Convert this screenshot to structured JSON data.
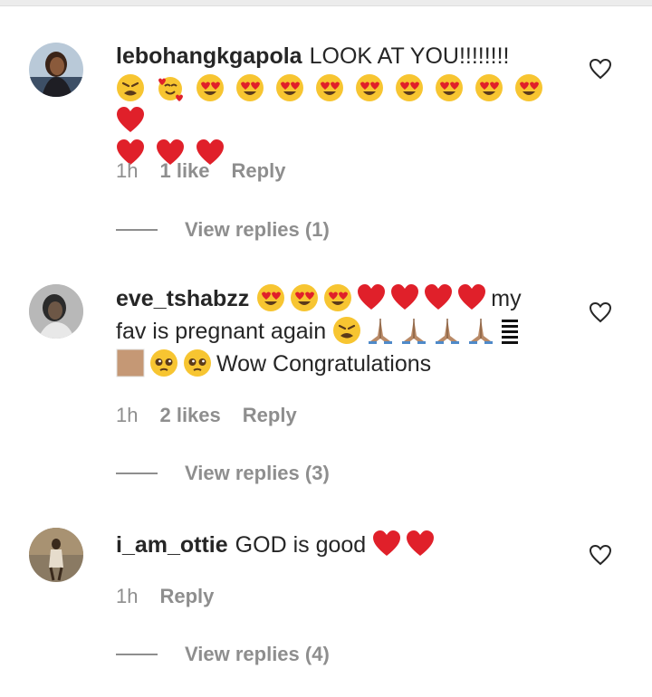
{
  "colors": {
    "text": "#262626",
    "secondary": "#8e8e8e",
    "heart_red": "#e0202a"
  },
  "comments": [
    {
      "username": "lebohangkgapola",
      "text_before": "LOOK AT YOU!!!!!!!!",
      "emojis_line": [
        "weary",
        "smiling-hearts",
        "heart-eyes",
        "heart-eyes",
        "heart-eyes",
        "heart-eyes",
        "heart-eyes",
        "heart-eyes",
        "heart-eyes",
        "heart-eyes",
        "heart-eyes",
        "red-heart",
        "red-heart",
        "red-heart",
        "red-heart"
      ],
      "time": "1h",
      "likes": "1 like",
      "reply_label": "Reply",
      "view_replies": "View replies (1)"
    },
    {
      "username": "eve_tshabzz",
      "text_after_emojis": "my fav is pregnant again",
      "text_end": "Wow Congratulations",
      "time": "1h",
      "likes": "2 likes",
      "reply_label": "Reply",
      "view_replies": "View replies (3)"
    },
    {
      "username": "i_am_ottie",
      "text": "GOD is good",
      "time": "1h",
      "reply_label": "Reply",
      "view_replies": "View replies (4)"
    }
  ]
}
